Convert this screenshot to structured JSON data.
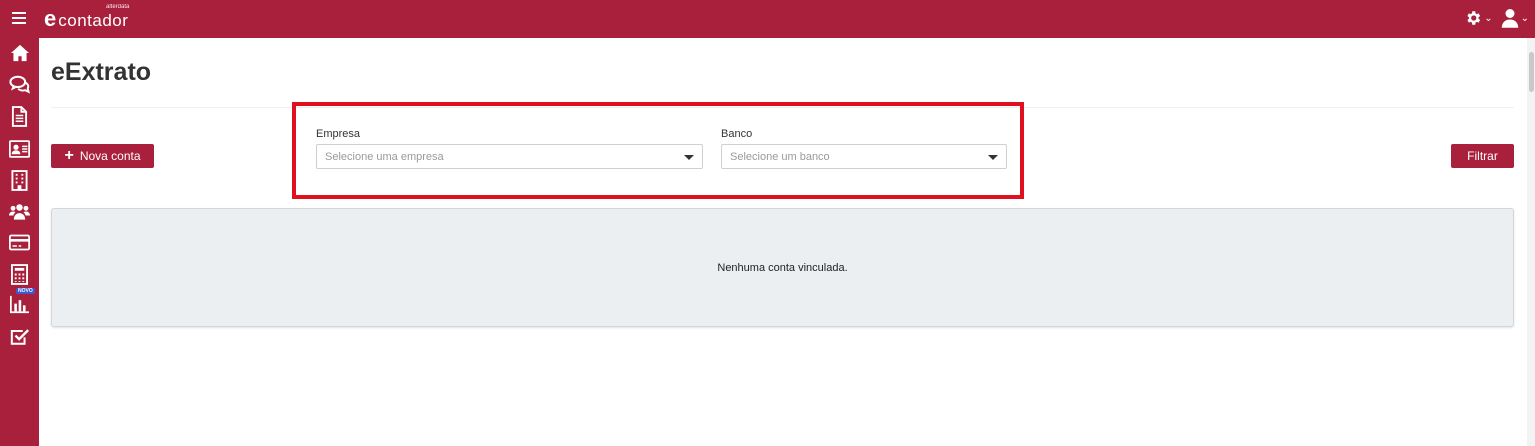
{
  "brand": {
    "logo_mark": "e",
    "logo_word": "contador",
    "logo_small": "alterdata",
    "primary_color": "#a8203b"
  },
  "header": {
    "menu_icon": "hamburger-icon",
    "settings_icon": "gear-icon",
    "user_icon": "user-icon",
    "chevron": "⌄"
  },
  "sidebar": {
    "items": [
      {
        "icon": "home-icon"
      },
      {
        "icon": "chat-icon"
      },
      {
        "icon": "document-icon"
      },
      {
        "icon": "id-card-icon"
      },
      {
        "icon": "building-icon"
      },
      {
        "icon": "users-icon"
      },
      {
        "icon": "credit-card-icon"
      },
      {
        "icon": "calculator-icon"
      },
      {
        "icon": "bar-chart-icon",
        "badge": "NOVO"
      },
      {
        "icon": "checkbox-icon"
      }
    ]
  },
  "page": {
    "title": "eExtrato",
    "new_account_label": "Nova conta",
    "filter_label": "Filtrar",
    "empty_message": "Nenhuma conta vinculada."
  },
  "filters": {
    "empresa_label": "Empresa",
    "empresa_placeholder": "Selecione uma empresa",
    "banco_label": "Banco",
    "banco_placeholder": "Selecione um banco"
  }
}
